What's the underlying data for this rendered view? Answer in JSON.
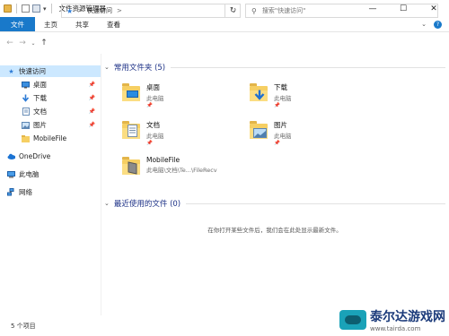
{
  "window": {
    "title": "文件资源管理器",
    "controls": [
      "—",
      "☐",
      "✕"
    ]
  },
  "ribbon": {
    "tabs": [
      "文件",
      "主页",
      "共享",
      "查看"
    ]
  },
  "address": {
    "crumb": "快速访问",
    "separator": ">"
  },
  "search": {
    "placeholder": "搜索\"快速访问\""
  },
  "sidebar": {
    "items": [
      {
        "label": "快速访问",
        "icon": "star-pin-icon"
      },
      {
        "label": "桌面",
        "icon": "desktop-icon"
      },
      {
        "label": "下载",
        "icon": "download-icon"
      },
      {
        "label": "文档",
        "icon": "document-icon"
      },
      {
        "label": "图片",
        "icon": "picture-icon"
      },
      {
        "label": "MobileFile",
        "icon": "folder-icon"
      },
      {
        "label": "OneDrive",
        "icon": "cloud-icon"
      },
      {
        "label": "此电脑",
        "icon": "computer-icon"
      },
      {
        "label": "网络",
        "icon": "network-icon"
      }
    ]
  },
  "frequent": {
    "header": "常用文件夹 (5)",
    "folders": [
      {
        "name": "桌面",
        "location": "此电脑"
      },
      {
        "name": "下载",
        "location": "此电脑"
      },
      {
        "name": "文档",
        "location": "此电脑"
      },
      {
        "name": "图片",
        "location": "此电脑"
      },
      {
        "name": "MobileFile",
        "location": "此电脑\\文档\\Te...\\FileRecv"
      }
    ]
  },
  "recent": {
    "header": "最近使用的文件 (0)",
    "empty_message": "在你打开某些文件后，我们会在此处显示最新文件。"
  },
  "status": {
    "item_count": "5 个项目"
  },
  "watermark": {
    "name": "泰尔达游戏网",
    "url": "www.tairda.com"
  },
  "colors": {
    "accent": "#1979ca",
    "selected": "#cce8ff",
    "group_header": "#1e3287"
  }
}
